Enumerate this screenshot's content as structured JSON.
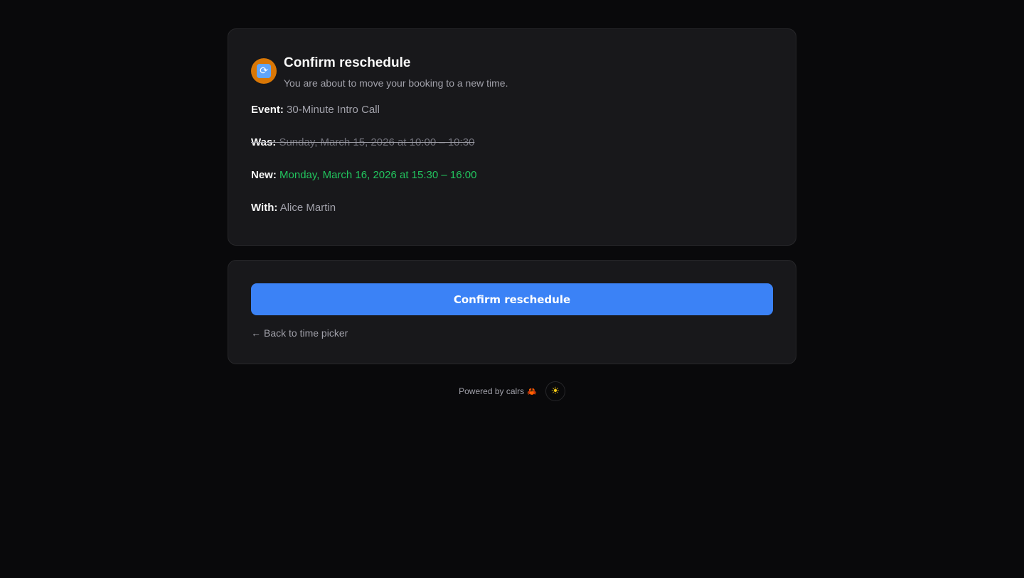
{
  "summary": {
    "icon": "reschedule-icon",
    "icon_glyph": "⟳",
    "title": "Confirm reschedule",
    "subtitle": "You are about to move your booking to a new time.",
    "event_label": "Event:",
    "event_value": "30-Minute Intro Call",
    "was_label": "Was:",
    "was_value": "Sunday, March 15, 2026 at 10:00 – 10:30",
    "new_label": "New:",
    "new_value": "Monday, March 16, 2026 at 15:30 – 16:00",
    "with_label": "With:",
    "with_value": "Alice Martin"
  },
  "actions": {
    "confirm_label": "Confirm reschedule",
    "back_arrow": "←",
    "back_label": "Back to time picker"
  },
  "footer": {
    "powered_label": "Powered by calrs",
    "crab_glyph": "🦀",
    "theme_glyph": "☀"
  },
  "colors": {
    "accent": "#3b82f6",
    "new_time": "#22c55e",
    "icon_bg": "#d97706"
  }
}
